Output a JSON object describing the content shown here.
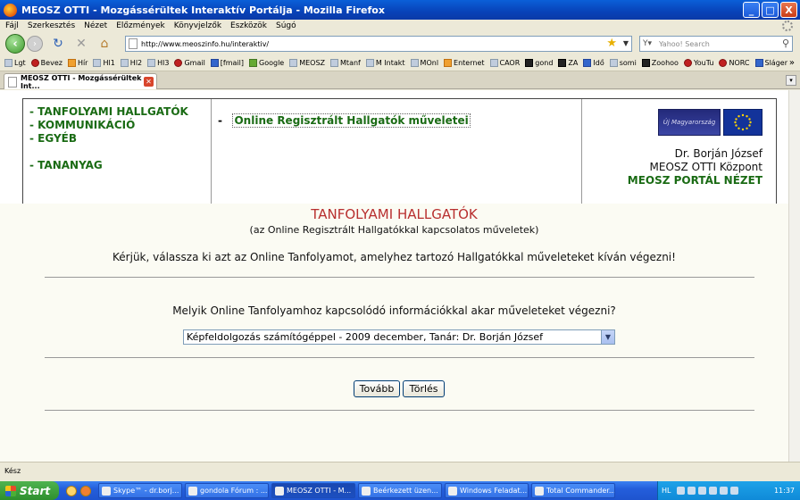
{
  "window": {
    "title": "MEOSZ OTTI - Mozgássérültek Interaktív Portálja - Mozilla Firefox",
    "controls": [
      "_",
      "□",
      "X"
    ]
  },
  "menu": [
    "Fájl",
    "Szerkesztés",
    "Nézet",
    "Előzmények",
    "Könyvjelzők",
    "Eszközök",
    "Súgó"
  ],
  "nav": {
    "url": "http://www.meoszinfo.hu/interaktiv/",
    "search_placeholder": "Yahoo! Search"
  },
  "bookmarks": [
    "Lgt",
    "Bevez",
    "Hír",
    "Hl1",
    "Hl2",
    "Hl3",
    "Gmail",
    "[fmail]",
    "Google",
    "MEOSZ",
    "Mtanf",
    "M Intakt",
    "MOnl",
    "Enternet",
    "CAOR",
    "gond",
    "ZA",
    "Idő",
    "somi",
    "Zoohoo",
    "YouTu",
    "NORC",
    "Sláger"
  ],
  "tab": {
    "label": "MEOSZ OTTI - Mozgássérültek Int..."
  },
  "site": {
    "left_nav": [
      "- TANFOLYAMI HALLGATÓK",
      "- KOMMUNIKÁCIÓ",
      "- EGYÉB",
      "- TANANYAG"
    ],
    "mid_nav_dash": "-",
    "mid_nav_link": "Online Regisztrált Hallgatók műveletei",
    "logo_text": "Új Magyarország",
    "person": "Dr. Borján József",
    "org": "MEOSZ OTTI Központ",
    "portal": "MEOSZ PORTÁL NÉZET"
  },
  "dialog": {
    "title": "TANFOLYAMI HALLGATÓK",
    "subtitle": "(az Online Regisztrált Hallgatókkal kapcsolatos műveletek)",
    "instruction": "Kérjük, válassza ki azt az Online Tanfolyamot, amelyhez tartozó Hallgatókkal műveleteket kíván végezni!",
    "question": "Melyik Online Tanfolyamhoz kapcsolódó információkkal akar műveleteket végezni?",
    "selected_course": "Képfeldolgozás számítógéppel - 2009 december, Tanár: Dr. Borján József",
    "next_button": "Tovább",
    "clear_button": "Törlés"
  },
  "status": "Kész",
  "taskbar": {
    "start": "Start",
    "tasks": [
      "Skype™ - dr.borj...",
      "gondola Fórum : ...",
      "MEOSZ OTTI - M...",
      "Beérkezett üzen...",
      "Windows Feladat...",
      "Total Commander..."
    ],
    "language": "HL",
    "clock": "11:37"
  }
}
